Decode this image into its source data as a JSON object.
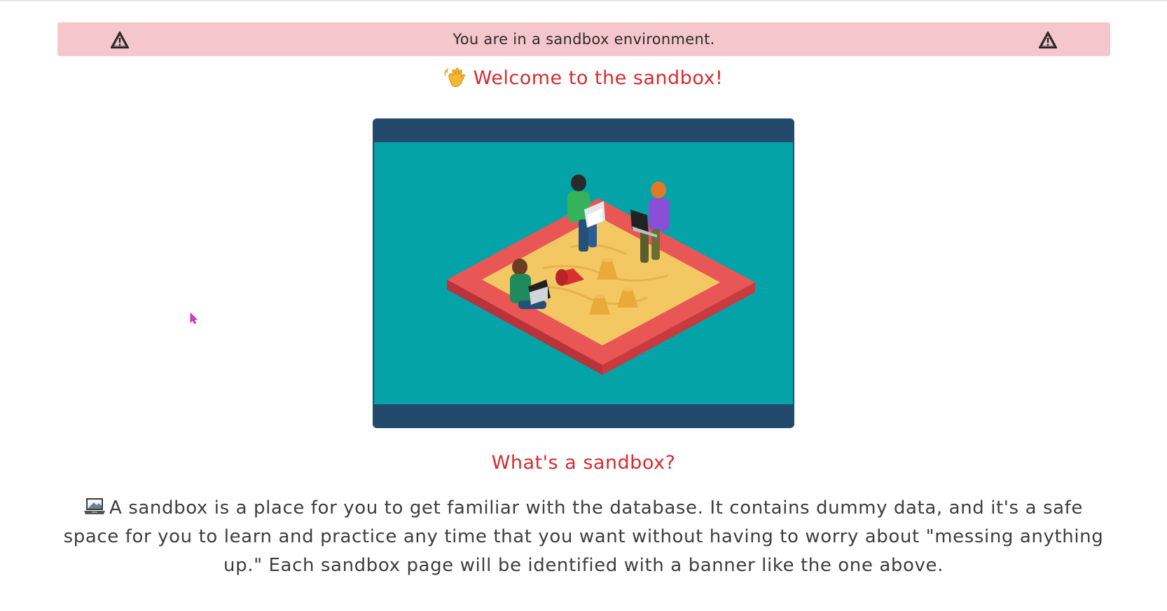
{
  "banner": {
    "text": "You are in a sandbox environment.",
    "left_icon": "warning-triangle-icon",
    "right_icon": "warning-triangle-icon",
    "background_color": "#f5c6cb"
  },
  "welcome": {
    "icon": "waving-hand-icon",
    "text": "Welcome to the sandbox!",
    "color": "#d62b32"
  },
  "illustration": {
    "icon": "sandbox-illustration",
    "frame_color": "#22496b",
    "background_color": "#04a3a8"
  },
  "section": {
    "heading": "What's a sandbox?",
    "icon": "laptop-icon",
    "body": "A sandbox is a place for you to get familiar with the database. It contains dummy data, and it's a safe space for you to learn and practice any time that you want without having to worry about \"messing anything up.\" Each sandbox page will be identified with a banner like the one above."
  }
}
